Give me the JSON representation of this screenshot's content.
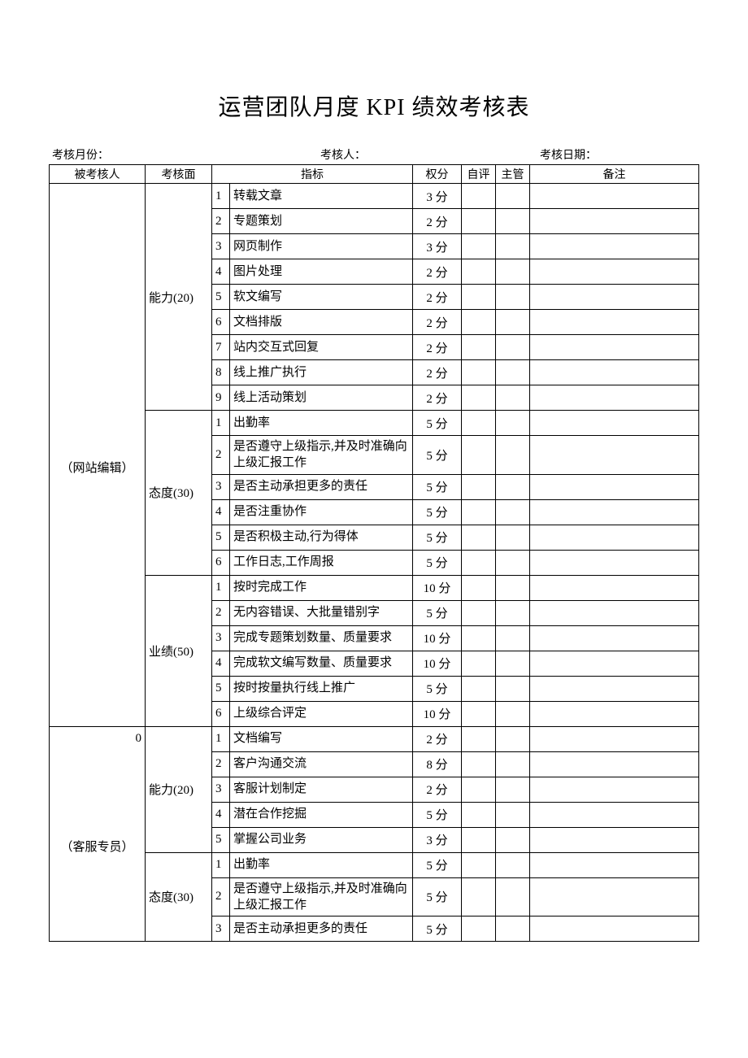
{
  "title": "运营团队月度 KPI 绩效考核表",
  "meta": {
    "month_label": "考核月份：",
    "assessor_label": "考核人：",
    "date_label": "考核日期：",
    "month_value": "",
    "assessor_value": "",
    "date_value": ""
  },
  "headers": {
    "subject": "被考核人",
    "aspect": "考核面",
    "metric": "指标",
    "weight": "权分",
    "self": "自评",
    "mgr": "主管",
    "note": "备注"
  },
  "subjects": [
    {
      "name": "（网站编辑）",
      "aspects": [
        {
          "name": "能力(20)",
          "items": [
            {
              "idx": "1",
              "metric": "转载文章",
              "weight": "3 分"
            },
            {
              "idx": "2",
              "metric": "专题策划",
              "weight": "2 分"
            },
            {
              "idx": "3",
              "metric": "网页制作",
              "weight": "3 分"
            },
            {
              "idx": "4",
              "metric": "图片处理",
              "weight": "2 分"
            },
            {
              "idx": "5",
              "metric": "软文编写",
              "weight": "2 分"
            },
            {
              "idx": "6",
              "metric": "文档排版",
              "weight": "2 分"
            },
            {
              "idx": "7",
              "metric": "站内交互式回复",
              "weight": "2 分"
            },
            {
              "idx": "8",
              "metric": "线上推广执行",
              "weight": "2 分"
            },
            {
              "idx": "9",
              "metric": "线上活动策划",
              "weight": "2 分"
            }
          ]
        },
        {
          "name": "态度(30)",
          "items": [
            {
              "idx": "1",
              "metric": "出勤率",
              "weight": "5 分"
            },
            {
              "idx": "2",
              "metric": "是否遵守上级指示,并及时准确向上级汇报工作",
              "weight": "5 分"
            },
            {
              "idx": "3",
              "metric": "是否主动承担更多的责任",
              "weight": "5 分"
            },
            {
              "idx": "4",
              "metric": "是否注重协作",
              "weight": "5 分"
            },
            {
              "idx": "5",
              "metric": "是否积极主动,行为得体",
              "weight": "5 分"
            },
            {
              "idx": "6",
              "metric": "工作日志,工作周报",
              "weight": "5 分"
            }
          ]
        },
        {
          "name": "业绩(50)",
          "items": [
            {
              "idx": "1",
              "metric": "按时完成工作",
              "weight": "10 分"
            },
            {
              "idx": "2",
              "metric": "无内容错误、大批量错别字",
              "weight": "5 分"
            },
            {
              "idx": "3",
              "metric": "完成专题策划数量、质量要求",
              "weight": "10 分"
            },
            {
              "idx": "4",
              "metric": "完成软文编写数量、质量要求",
              "weight": "10 分"
            },
            {
              "idx": "5",
              "metric": "按时按量执行线上推广",
              "weight": "5 分"
            },
            {
              "idx": "6",
              "metric": "上级综合评定",
              "weight": "10 分"
            }
          ]
        }
      ]
    },
    {
      "name": "（客服专员）",
      "zero_placeholder": "0",
      "aspects": [
        {
          "name": "能力(20)",
          "items": [
            {
              "idx": "1",
              "metric": "文档编写",
              "weight": "2 分"
            },
            {
              "idx": "2",
              "metric": "客户沟通交流",
              "weight": "8 分"
            },
            {
              "idx": "3",
              "metric": "客服计划制定",
              "weight": "2 分"
            },
            {
              "idx": "4",
              "metric": "潜在合作挖掘",
              "weight": "5 分"
            },
            {
              "idx": "5",
              "metric": "掌握公司业务",
              "weight": "3 分"
            }
          ]
        },
        {
          "name": "态度(30)",
          "items": [
            {
              "idx": "1",
              "metric": "出勤率",
              "weight": "5 分"
            },
            {
              "idx": "2",
              "metric": "是否遵守上级指示,并及时准确向上级汇报工作",
              "weight": "5 分"
            },
            {
              "idx": "3",
              "metric": "是否主动承担更多的责任",
              "weight": "5 分"
            }
          ]
        }
      ]
    }
  ]
}
